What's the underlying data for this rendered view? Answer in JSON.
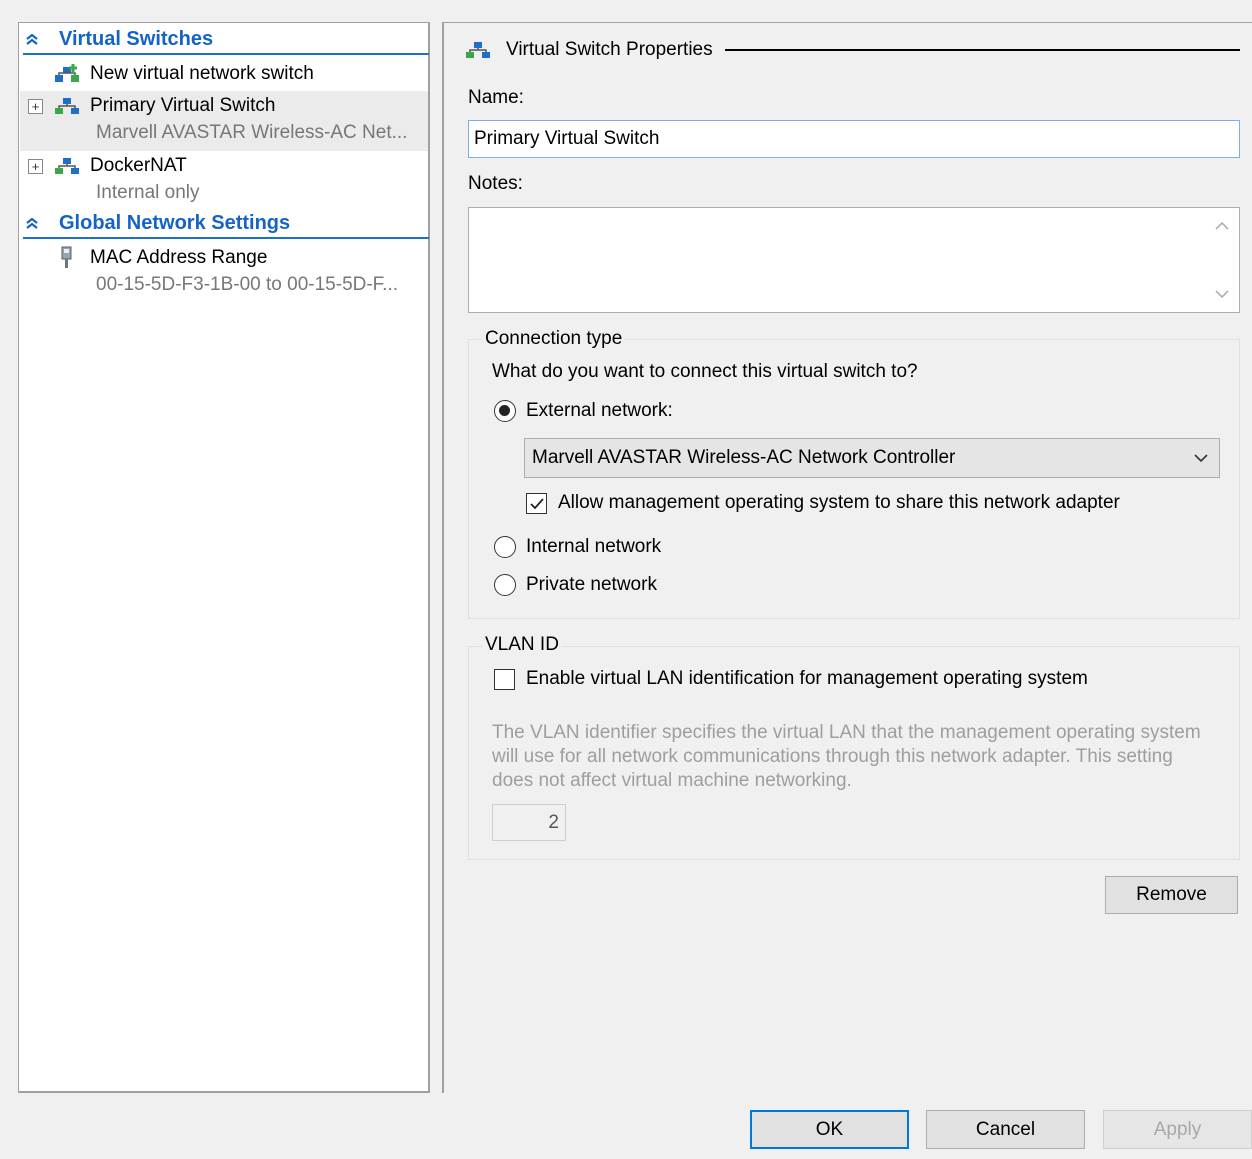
{
  "tree": {
    "virtual_switches_header": "Virtual Switches",
    "new_switch_label": "New virtual network switch",
    "switches": [
      {
        "name": "Primary Virtual Switch",
        "detail": "Marvell AVASTAR Wireless-AC Net..."
      },
      {
        "name": "DockerNAT",
        "detail": "Internal only"
      }
    ],
    "global_header": "Global Network Settings",
    "mac_label": "MAC Address Range",
    "mac_detail": "00-15-5D-F3-1B-00 to 00-15-5D-F..."
  },
  "props": {
    "header": "Virtual Switch Properties",
    "name_label": "Name:",
    "name_value": "Primary Virtual Switch",
    "notes_label": "Notes:",
    "notes_value": "",
    "connection": {
      "title": "Connection type",
      "question": "What do you want to connect this virtual switch to?",
      "external_label": "External network:",
      "adapter_selected": "Marvell AVASTAR Wireless-AC Network Controller",
      "share_label": "Allow management operating system to share this network adapter",
      "internal_label": "Internal network",
      "private_label": "Private network"
    },
    "vlan": {
      "title": "VLAN ID",
      "enable_label": "Enable virtual LAN identification for management operating system",
      "description": "The VLAN identifier specifies the virtual LAN that the management operating system will use for all network communications through this network adapter. This setting does not affect virtual machine networking.",
      "value": "2"
    },
    "remove_label": "Remove"
  },
  "footer": {
    "ok_label": "OK",
    "cancel_label": "Cancel",
    "apply_label": "Apply"
  },
  "colors": {
    "section_header": "#1464c8",
    "switch_icon_green": "#3aa84a",
    "switch_icon_blue": "#1e6fc8"
  }
}
